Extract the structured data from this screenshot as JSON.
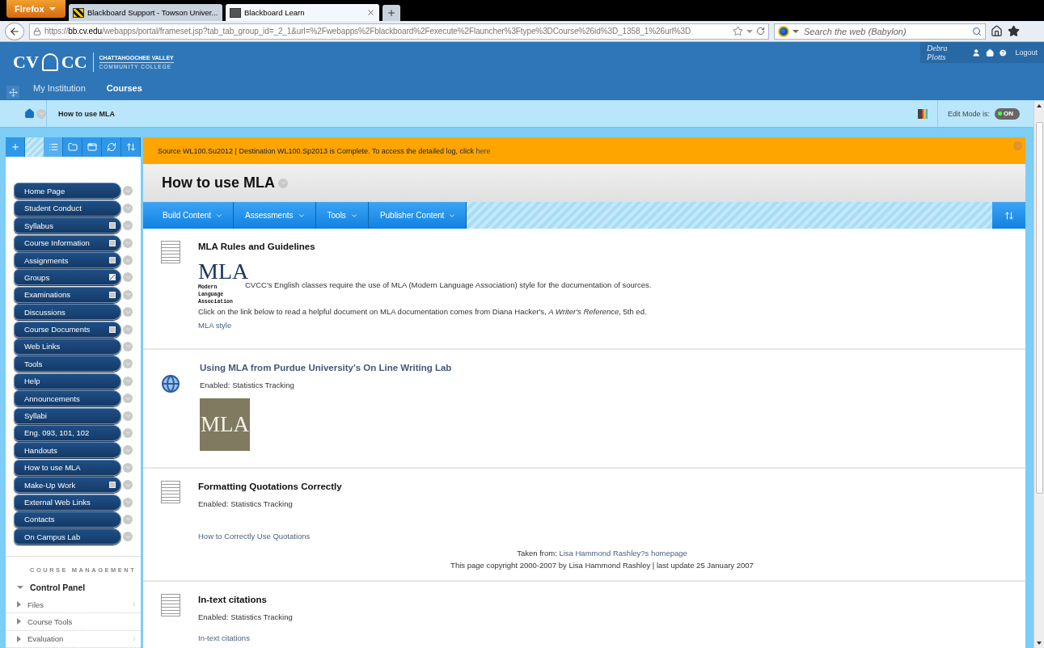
{
  "browser": {
    "menu_button": "Firefox",
    "tabs": [
      {
        "title": "Blackboard Support - Towson Univer...",
        "selected": false
      },
      {
        "title": "Blackboard Learn",
        "selected": true
      }
    ],
    "url": "https://**bb.cv.edu**/webapps/portal/frameset.jsp?tab_tab_group_id=_2_1&url=%2Fwebapps%2Fblackboard%2Fexecute%2Flauncher%3Ftype%3DCourse%26id%3D_1358_1%26url%3D",
    "search": {
      "placeholder": "Search the web (Babylon)"
    }
  },
  "header": {
    "logo": {
      "left": "CV",
      "right": "CC",
      "name": "CHATTAHOOCHEE VALLEY",
      "subname": "COMMUNITY COLLEGE"
    },
    "tabs": [
      {
        "label": "My Institution",
        "selected": false
      },
      {
        "label": "Courses",
        "selected": true
      }
    ],
    "user": {
      "name": "Debra Plotts",
      "logout": "Logout"
    }
  },
  "breadcrumb": {
    "current": "How to use MLA",
    "edit_mode": {
      "label": "Edit Mode is:",
      "on": true,
      "state_text": "ON"
    }
  },
  "sidebar": {
    "tools": [
      {
        "kind": "add",
        "selected": false
      },
      {
        "kind": "list",
        "selected": true
      },
      {
        "kind": "folder",
        "selected": false
      },
      {
        "kind": "window",
        "selected": false
      },
      {
        "kind": "refresh",
        "selected": false
      },
      {
        "kind": "sort",
        "selected": false
      }
    ],
    "menu": [
      {
        "label": "Home Page",
        "kind": "plain"
      },
      {
        "label": "Student Conduct",
        "kind": "plain"
      },
      {
        "label": "Syllabus",
        "kind": "page"
      },
      {
        "label": "Course Information",
        "kind": "page"
      },
      {
        "label": "Assignments",
        "kind": "page"
      },
      {
        "label": "Groups",
        "kind": "edit"
      },
      {
        "label": "Examinations",
        "kind": "page"
      },
      {
        "label": "Discussions",
        "kind": "plain"
      },
      {
        "label": "Course Documents",
        "kind": "page"
      },
      {
        "label": "Web Links",
        "kind": "plain"
      },
      {
        "label": "Tools",
        "kind": "plain"
      },
      {
        "label": "Help",
        "kind": "plain"
      },
      {
        "label": "Announcements",
        "kind": "plain"
      },
      {
        "label": "Syllabi",
        "kind": "plain"
      },
      {
        "label": "Eng. 093, 101, 102",
        "kind": "plain"
      },
      {
        "label": "Handouts",
        "kind": "plain"
      },
      {
        "label": "How to use MLA",
        "kind": "plain"
      },
      {
        "label": "Make-Up Work",
        "kind": "page"
      },
      {
        "label": "External Web Links",
        "kind": "plain"
      },
      {
        "label": "Contacts",
        "kind": "plain"
      },
      {
        "label": "On Campus Lab",
        "kind": "plain"
      }
    ],
    "management": {
      "heading": "COURSE MANAGEMENT",
      "items": [
        {
          "label": "Control Panel",
          "expanded": true,
          "submenu": false
        },
        {
          "label": "Files",
          "expanded": false,
          "submenu": true
        },
        {
          "label": "Course Tools",
          "expanded": false,
          "submenu": false
        },
        {
          "label": "Evaluation",
          "expanded": false,
          "submenu": true
        }
      ]
    }
  },
  "notice": {
    "text": "Source WL100.Su2012 | Destination WL100.Sp2013 is Complete. To access the detailed log, click ",
    "link": "here"
  },
  "page_title": "How to use MLA",
  "action_bar": [
    "Build Content",
    "Assessments",
    "Tools",
    "Publisher Content"
  ],
  "items": [
    {
      "kind": "document",
      "title": "MLA Rules and Guidelines",
      "title_link": false,
      "logo": {
        "big": "MLA",
        "lines": [
          "Modern",
          "Language",
          "Association"
        ]
      },
      "intro": "CVCC's English classes require the use of MLA (Modern Language Association) style for the documentation of sources.",
      "text": "Click on the link below to read a helpful document on MLA documentation comes from Diana Hacker's, *A Writer's Reference*, 5th ed.",
      "links": [
        "MLA style"
      ]
    },
    {
      "kind": "web_link",
      "title": "Using MLA from Purdue University's On Line Writing Lab",
      "title_link": true,
      "tracking": "Enabled:  Statistics Tracking",
      "image_text": "MLA"
    },
    {
      "kind": "document",
      "title": "Formatting Quotations Correctly",
      "title_link": false,
      "tracking": "Enabled:  Statistics Tracking",
      "links": [
        "How to Correctly Use Quotations"
      ],
      "credit": {
        "prefix": "Taken from: ",
        "link": "Lisa Hammond Rashley?s homepage",
        "line": "This page copyright 2000-2007 by Lisa Hammond Rashley | last update 25 January 2007"
      }
    },
    {
      "kind": "document",
      "title": "In-text citations",
      "title_link": false,
      "tracking": "Enabled:  Statistics Tracking",
      "links": [
        "In-text citations"
      ]
    }
  ]
}
